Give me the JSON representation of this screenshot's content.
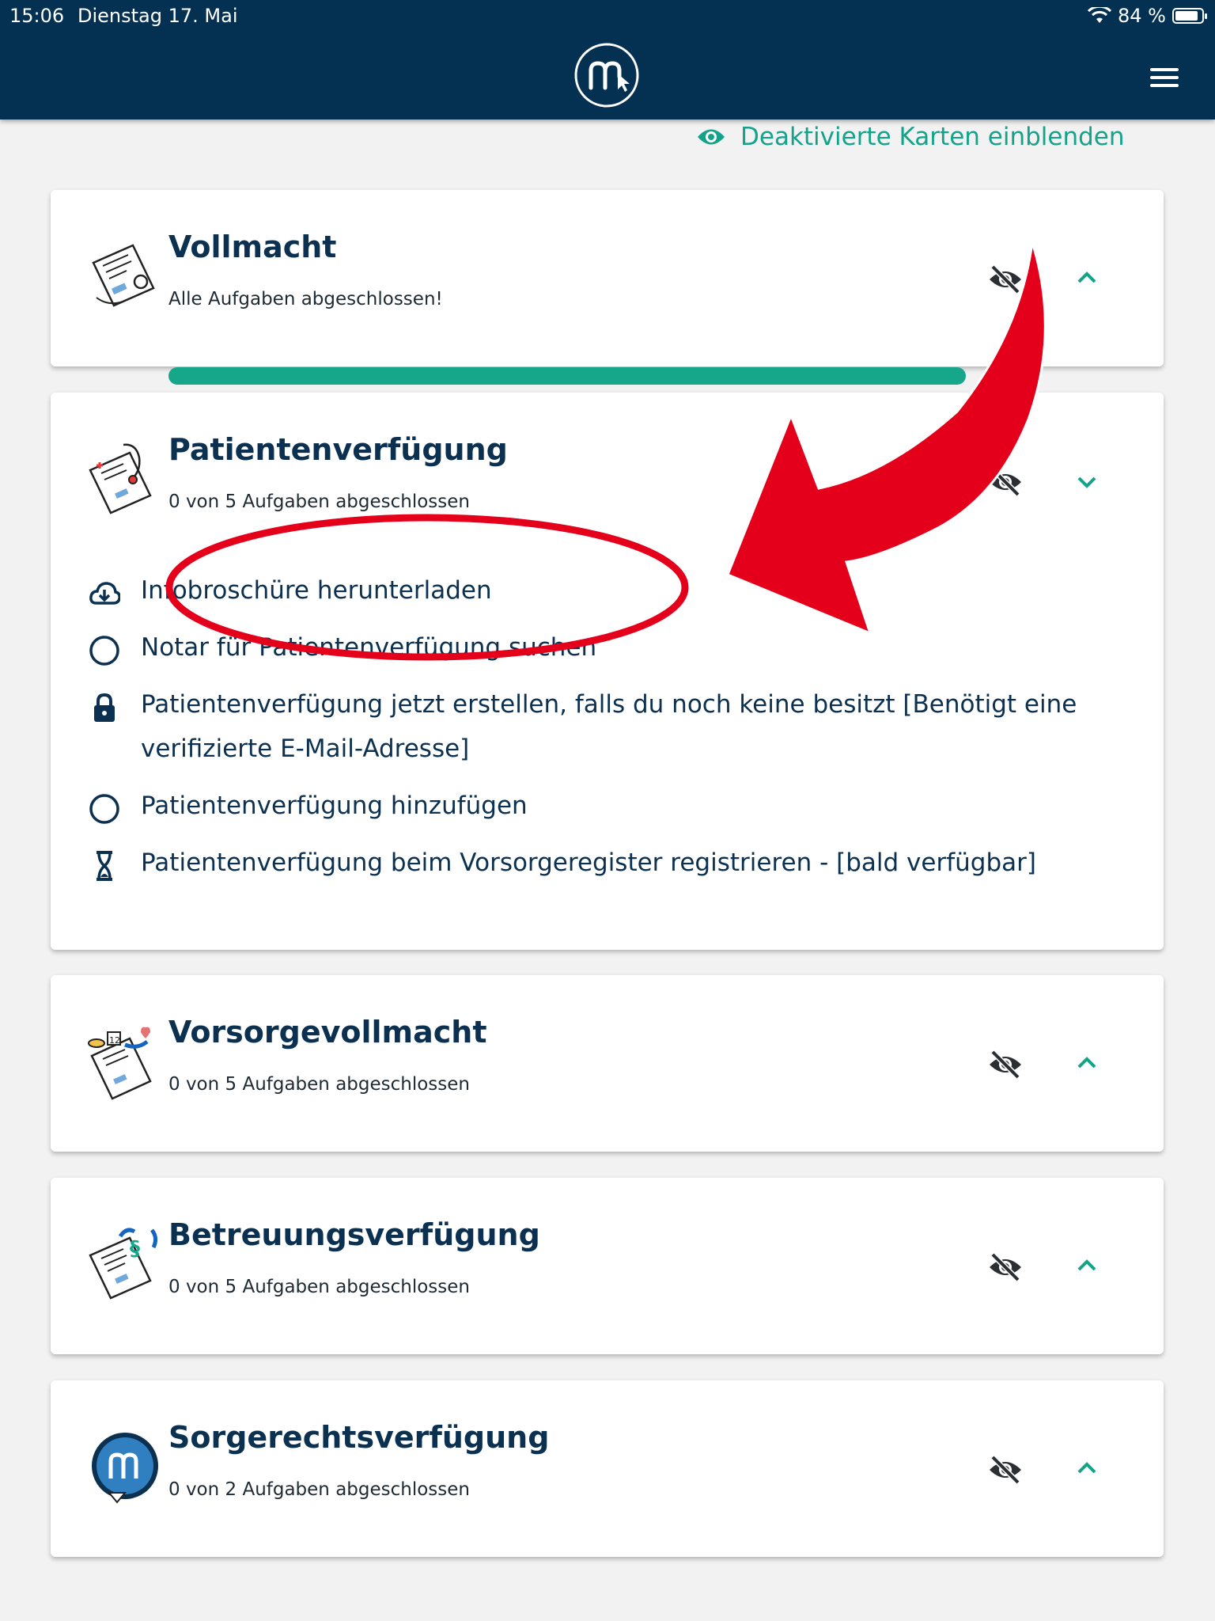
{
  "status_bar": {
    "time": "15:06",
    "date": "Dienstag 17. Mai",
    "battery": "84 %"
  },
  "header": {
    "logo_icon": "mein-logo-icon",
    "menu_icon": "hamburger-menu-icon"
  },
  "show_disabled": {
    "label": "Deaktivierte Karten einblenden",
    "icon": "eye-icon"
  },
  "cards": [
    {
      "title": "Vollmacht",
      "subtitle": "Alle Aufgaben abgeschlossen!",
      "progress": 1.0,
      "expanded": false
    },
    {
      "title": "Patientenverfügung",
      "subtitle": "0 von 5 Aufgaben abgeschlossen",
      "expanded": true,
      "tasks": [
        {
          "label": "Infobroschüre herunterladen",
          "icon": "cloud-download-icon"
        },
        {
          "label": "Notar für Patientenverfügung suchen",
          "icon": "circle-icon"
        },
        {
          "label": "Patientenverfügung jetzt erstellen, falls du noch keine besitzt [Benötigt eine verifizierte E-Mail-Adresse]",
          "icon": "lock-icon"
        },
        {
          "label": "Patientenverfügung hinzufügen",
          "icon": "circle-icon"
        },
        {
          "label": "Patientenverfügung beim Vorsorgeregister registrieren - [bald verfügbar]",
          "icon": "hourglass-icon"
        }
      ]
    },
    {
      "title": "Vorsorgevollmacht",
      "subtitle": "0 von 5 Aufgaben abgeschlossen",
      "expanded": false
    },
    {
      "title": "Betreuungsverfügung",
      "subtitle": "0 von 5 Aufgaben abgeschlossen",
      "expanded": false
    },
    {
      "title": "Sorgerechtsverfügung",
      "subtitle": "0 von 2 Aufgaben abgeschlossen",
      "expanded": false
    }
  ],
  "colors": {
    "header_bg": "#043152",
    "accent": "#16a78a",
    "title": "#0b3050",
    "annotation": "#e4001b"
  }
}
